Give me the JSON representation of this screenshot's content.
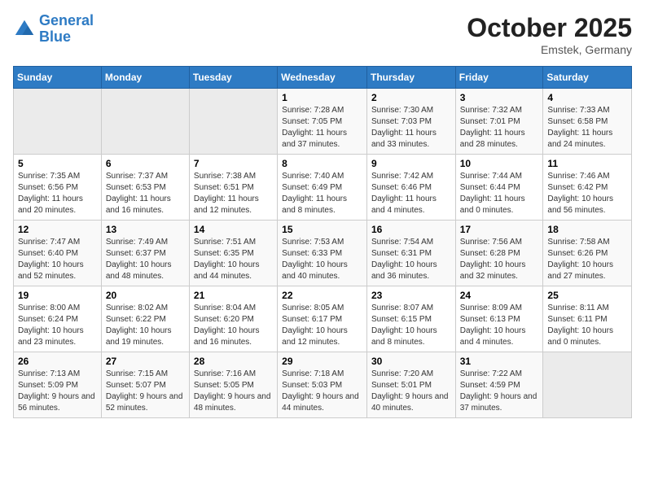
{
  "logo": {
    "line1": "General",
    "line2": "Blue"
  },
  "title": "October 2025",
  "subtitle": "Emstek, Germany",
  "weekdays": [
    "Sunday",
    "Monday",
    "Tuesday",
    "Wednesday",
    "Thursday",
    "Friday",
    "Saturday"
  ],
  "weeks": [
    [
      {
        "day": "",
        "info": ""
      },
      {
        "day": "",
        "info": ""
      },
      {
        "day": "",
        "info": ""
      },
      {
        "day": "1",
        "info": "Sunrise: 7:28 AM\nSunset: 7:05 PM\nDaylight: 11 hours and 37 minutes."
      },
      {
        "day": "2",
        "info": "Sunrise: 7:30 AM\nSunset: 7:03 PM\nDaylight: 11 hours and 33 minutes."
      },
      {
        "day": "3",
        "info": "Sunrise: 7:32 AM\nSunset: 7:01 PM\nDaylight: 11 hours and 28 minutes."
      },
      {
        "day": "4",
        "info": "Sunrise: 7:33 AM\nSunset: 6:58 PM\nDaylight: 11 hours and 24 minutes."
      }
    ],
    [
      {
        "day": "5",
        "info": "Sunrise: 7:35 AM\nSunset: 6:56 PM\nDaylight: 11 hours and 20 minutes."
      },
      {
        "day": "6",
        "info": "Sunrise: 7:37 AM\nSunset: 6:53 PM\nDaylight: 11 hours and 16 minutes."
      },
      {
        "day": "7",
        "info": "Sunrise: 7:38 AM\nSunset: 6:51 PM\nDaylight: 11 hours and 12 minutes."
      },
      {
        "day": "8",
        "info": "Sunrise: 7:40 AM\nSunset: 6:49 PM\nDaylight: 11 hours and 8 minutes."
      },
      {
        "day": "9",
        "info": "Sunrise: 7:42 AM\nSunset: 6:46 PM\nDaylight: 11 hours and 4 minutes."
      },
      {
        "day": "10",
        "info": "Sunrise: 7:44 AM\nSunset: 6:44 PM\nDaylight: 11 hours and 0 minutes."
      },
      {
        "day": "11",
        "info": "Sunrise: 7:46 AM\nSunset: 6:42 PM\nDaylight: 10 hours and 56 minutes."
      }
    ],
    [
      {
        "day": "12",
        "info": "Sunrise: 7:47 AM\nSunset: 6:40 PM\nDaylight: 10 hours and 52 minutes."
      },
      {
        "day": "13",
        "info": "Sunrise: 7:49 AM\nSunset: 6:37 PM\nDaylight: 10 hours and 48 minutes."
      },
      {
        "day": "14",
        "info": "Sunrise: 7:51 AM\nSunset: 6:35 PM\nDaylight: 10 hours and 44 minutes."
      },
      {
        "day": "15",
        "info": "Sunrise: 7:53 AM\nSunset: 6:33 PM\nDaylight: 10 hours and 40 minutes."
      },
      {
        "day": "16",
        "info": "Sunrise: 7:54 AM\nSunset: 6:31 PM\nDaylight: 10 hours and 36 minutes."
      },
      {
        "day": "17",
        "info": "Sunrise: 7:56 AM\nSunset: 6:28 PM\nDaylight: 10 hours and 32 minutes."
      },
      {
        "day": "18",
        "info": "Sunrise: 7:58 AM\nSunset: 6:26 PM\nDaylight: 10 hours and 27 minutes."
      }
    ],
    [
      {
        "day": "19",
        "info": "Sunrise: 8:00 AM\nSunset: 6:24 PM\nDaylight: 10 hours and 23 minutes."
      },
      {
        "day": "20",
        "info": "Sunrise: 8:02 AM\nSunset: 6:22 PM\nDaylight: 10 hours and 19 minutes."
      },
      {
        "day": "21",
        "info": "Sunrise: 8:04 AM\nSunset: 6:20 PM\nDaylight: 10 hours and 16 minutes."
      },
      {
        "day": "22",
        "info": "Sunrise: 8:05 AM\nSunset: 6:17 PM\nDaylight: 10 hours and 12 minutes."
      },
      {
        "day": "23",
        "info": "Sunrise: 8:07 AM\nSunset: 6:15 PM\nDaylight: 10 hours and 8 minutes."
      },
      {
        "day": "24",
        "info": "Sunrise: 8:09 AM\nSunset: 6:13 PM\nDaylight: 10 hours and 4 minutes."
      },
      {
        "day": "25",
        "info": "Sunrise: 8:11 AM\nSunset: 6:11 PM\nDaylight: 10 hours and 0 minutes."
      }
    ],
    [
      {
        "day": "26",
        "info": "Sunrise: 7:13 AM\nSunset: 5:09 PM\nDaylight: 9 hours and 56 minutes."
      },
      {
        "day": "27",
        "info": "Sunrise: 7:15 AM\nSunset: 5:07 PM\nDaylight: 9 hours and 52 minutes."
      },
      {
        "day": "28",
        "info": "Sunrise: 7:16 AM\nSunset: 5:05 PM\nDaylight: 9 hours and 48 minutes."
      },
      {
        "day": "29",
        "info": "Sunrise: 7:18 AM\nSunset: 5:03 PM\nDaylight: 9 hours and 44 minutes."
      },
      {
        "day": "30",
        "info": "Sunrise: 7:20 AM\nSunset: 5:01 PM\nDaylight: 9 hours and 40 minutes."
      },
      {
        "day": "31",
        "info": "Sunrise: 7:22 AM\nSunset: 4:59 PM\nDaylight: 9 hours and 37 minutes."
      },
      {
        "day": "",
        "info": ""
      }
    ]
  ]
}
